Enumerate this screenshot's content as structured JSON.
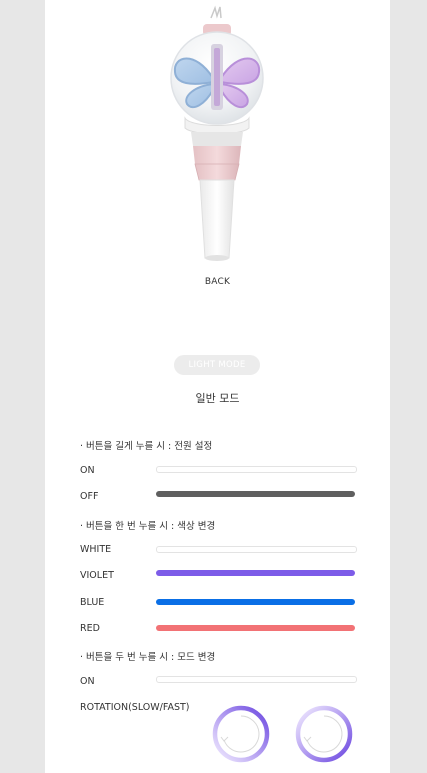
{
  "product": {
    "view_label": "BACK"
  },
  "mode": {
    "pill_label": "LIGHT MODE",
    "subtitle": "일반 모드"
  },
  "sections": [
    {
      "title": "· 버튼을 길게 누를 시 : 전원 설정",
      "rows": [
        {
          "label": "ON",
          "color": "#ffffff",
          "style": "outline"
        },
        {
          "label": "OFF",
          "color": "#5f5f5f",
          "style": "solid"
        }
      ]
    },
    {
      "title": "· 버튼을 한 번 누를 시 : 색상 변경",
      "rows": [
        {
          "label": "WHITE",
          "color": "#ffffff",
          "style": "outline"
        },
        {
          "label": "VIOLET",
          "color": "#7d5ce8",
          "style": "solid"
        },
        {
          "label": "BLUE",
          "color": "#0a6fe6",
          "style": "solid"
        },
        {
          "label": "RED",
          "color": "#f27275",
          "style": "solid"
        }
      ]
    },
    {
      "title": "· 버튼을 두 번 누를 시 : 모드 변경",
      "rows": [
        {
          "label": "ON",
          "color": "#ffffff",
          "style": "outline"
        },
        {
          "label": "ROTATION(SLOW/FAST)",
          "style": "rings",
          "icons": [
            "rotation-slow-ring-icon",
            "rotation-fast-ring-icon"
          ]
        }
      ]
    }
  ]
}
